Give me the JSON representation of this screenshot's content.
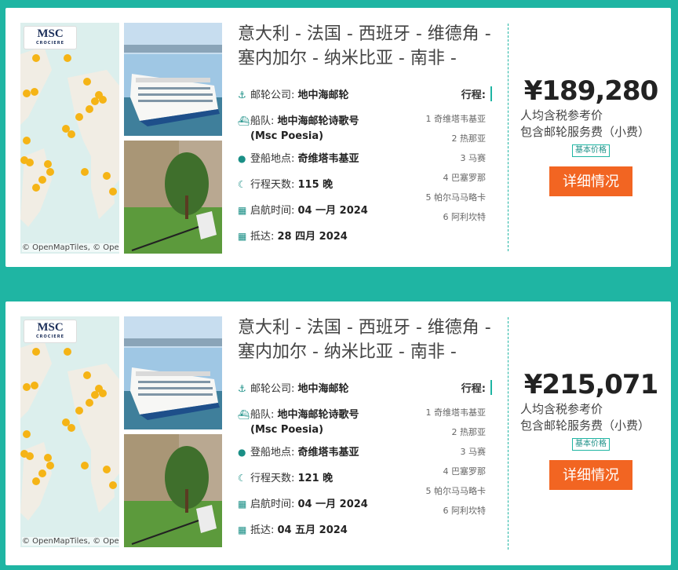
{
  "cards": [
    {
      "map_attribution": "© OpenMapTiles, © Ope",
      "logo": "MSC",
      "logo_sub": "CROCIERE",
      "title": "意大利 - 法国 - 西班牙 - 维德角 - 塞内加尔 - 纳米比亚 - 南非 -",
      "company_label": "邮轮公司: ",
      "company": "地中海邮轮",
      "fleet_label": "船队: ",
      "fleet": "地中海邮轮诗歌号 (Msc Poesia)",
      "port_label": "登船地点: ",
      "port": "奇维塔韦基亚",
      "days_label": "行程天数: ",
      "days": "115 晚",
      "depart_label": "启航时间: ",
      "depart": "04 一月 2024",
      "arrive_label": "抵达: ",
      "arrive": "28 四月 2024",
      "itinerary_title": "行程:",
      "itinerary": [
        "1 奇维塔韦基亚",
        "2 热那亚",
        "3 马赛",
        "4 巴塞罗那",
        "5 帕尔马马略卡",
        "6 阿利坎特"
      ],
      "price": "¥189,280",
      "price_note_1": "人均含税参考价",
      "price_note_2": "包含邮轮服务费（小费）",
      "badge": "基本价格",
      "button": "详细情况"
    },
    {
      "map_attribution": "© OpenMapTiles, © Ope",
      "logo": "MSC",
      "logo_sub": "CROCIERE",
      "title": "意大利 - 法国 - 西班牙 - 维德角 - 塞内加尔 - 纳米比亚 - 南非 -",
      "company_label": "邮轮公司: ",
      "company": "地中海邮轮",
      "fleet_label": "船队: ",
      "fleet": "地中海邮轮诗歌号 (Msc Poesia)",
      "port_label": "登船地点: ",
      "port": "奇维塔韦基亚",
      "days_label": "行程天数: ",
      "days": "121 晚",
      "depart_label": "启航时间: ",
      "depart": "04 一月 2024",
      "arrive_label": "抵达: ",
      "arrive": "04 五月 2024",
      "itinerary_title": "行程:",
      "itinerary": [
        "1 奇维塔韦基亚",
        "2 热那亚",
        "3 马赛",
        "4 巴塞罗那",
        "5 帕尔马马略卡",
        "6 阿利坎特"
      ],
      "price": "¥215,071",
      "price_note_1": "人均含税参考价",
      "price_note_2": "包含邮轮服务费（小费）",
      "badge": "基本价格",
      "button": "详细情况"
    }
  ],
  "icons": {
    "company": "anchor-icon",
    "fleet": "ship-icon",
    "port": "location-pin-icon",
    "days": "moon-icon",
    "depart": "calendar-icon",
    "arrive": "calendar-icon"
  },
  "colors": {
    "accent": "#1fb5a3",
    "button": "#f26522",
    "map_marker": "#f5b416"
  }
}
